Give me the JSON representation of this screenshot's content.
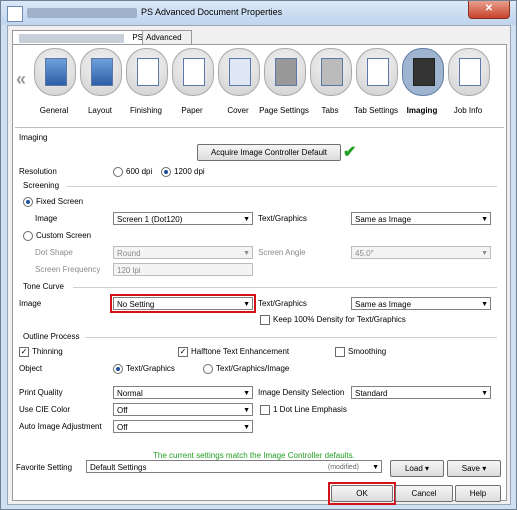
{
  "window": {
    "title": "PS Advanced Document Properties",
    "close_glyph": "✕"
  },
  "tabs": [
    {
      "label": "PS"
    },
    {
      "label": "Advanced"
    }
  ],
  "nav": {
    "left_arrow": "«"
  },
  "categories": [
    {
      "label": "General"
    },
    {
      "label": "Layout"
    },
    {
      "label": "Finishing"
    },
    {
      "label": "Paper"
    },
    {
      "label": "Cover"
    },
    {
      "label": "Page Settings"
    },
    {
      "label": "Tabs"
    },
    {
      "label": "Tab Settings"
    },
    {
      "label": "Imaging"
    },
    {
      "label": "Job Info"
    }
  ],
  "imaging": {
    "section": "Imaging",
    "acquire_button": "Acquire Image Controller Default",
    "resolution": {
      "label": "Resolution",
      "opt1": "600 dpi",
      "opt2": "1200 dpi"
    }
  },
  "screening": {
    "section": "Screening",
    "fixed": "Fixed Screen",
    "image_label": "Image",
    "image_value": "Screen 1 (Dot120)",
    "tg_label": "Text/Graphics",
    "tg_value": "Same as Image",
    "custom": "Custom Screen",
    "dot_label": "Dot Shape",
    "dot_value": "Round",
    "angle_label": "Screen Angle",
    "angle_value": "45.0°",
    "freq_label": "Screen Frequency",
    "freq_value": "120 lpi"
  },
  "tone": {
    "section": "Tone Curve",
    "image_label": "Image",
    "image_value": "No Setting",
    "tg_label": "Text/Graphics",
    "tg_value": "Same as Image",
    "keep": "Keep 100% Density for Text/Graphics"
  },
  "outline": {
    "section": "Outline Process",
    "thinning": "Thinning",
    "halftone": "Halftone Text Enhancement",
    "smoothing": "Smoothing",
    "object_label": "Object",
    "obj1": "Text/Graphics",
    "obj2": "Text/Graphics/Image"
  },
  "quality": {
    "pq_label": "Print Quality",
    "pq_value": "Normal",
    "cie_label": "Use CIE Color",
    "cie_value": "Off",
    "auto_label": "Auto Image Adjustment",
    "auto_value": "Off",
    "ids_label": "Image Density Selection",
    "ids_value": "Standard",
    "dot_line": "1 Dot Line Emphasis"
  },
  "status": "The current settings match the Image Controller defaults.",
  "favorite": {
    "label": "Favorite Setting",
    "value": "Default Settings",
    "modified": "(modified)",
    "load": "Load",
    "save": "Save"
  },
  "buttons": {
    "ok": "OK",
    "cancel": "Cancel",
    "help": "Help"
  },
  "colors": {
    "highlight": "#d1121a",
    "status": "#23a023"
  }
}
